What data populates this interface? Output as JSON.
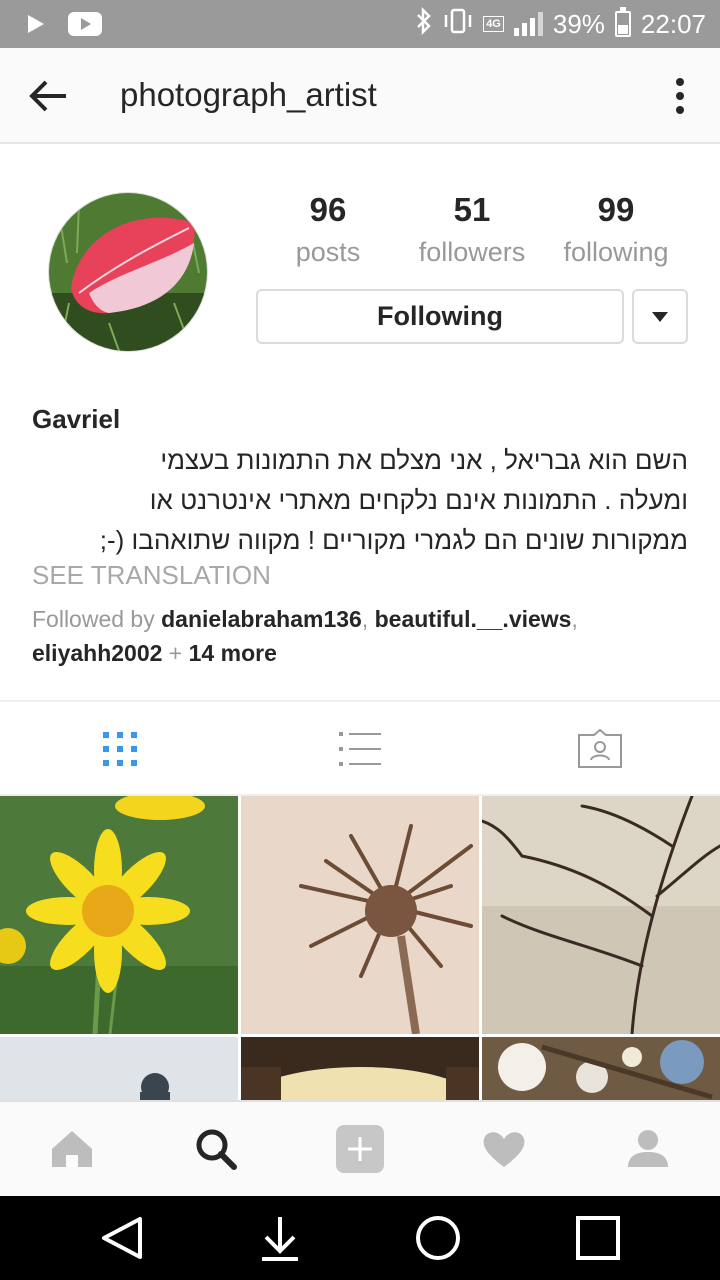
{
  "status_bar": {
    "battery": "39%",
    "time": "22:07",
    "network": "4G"
  },
  "app_bar": {
    "username": "photograph_artist"
  },
  "profile": {
    "stats": [
      {
        "value": "96",
        "label": "posts"
      },
      {
        "value": "51",
        "label": "followers"
      },
      {
        "value": "99",
        "label": "following"
      }
    ],
    "follow_button": "Following",
    "full_name": "Gavriel",
    "bio_lines": [
      "השם הוא גבריאל , אני מצלם את התמונות בעצמי",
      "ומעלה . התמונות אינם נלקחים מאתרי אינטרנט או",
      "ממקורות שונים הם לגמרי מקוריים ! מקווה שתואהבו (-;"
    ],
    "see_translation": "SEE TRANSLATION",
    "followed_by": {
      "prefix": "Followed by",
      "users": [
        "danielabraham136",
        "beautiful.__.views",
        "eliyahh2002"
      ],
      "more": "14 more"
    }
  },
  "tabs": [
    {
      "name": "grid-view-icon",
      "active": true
    },
    {
      "name": "list-view-icon",
      "active": false
    },
    {
      "name": "tagged-photos-icon",
      "active": false
    }
  ],
  "colors": {
    "accent": "#3897f0",
    "icon_inactive": "#999999",
    "status_bar": "#9a9a9a"
  },
  "bottom_nav": [
    "home-icon",
    "search-icon",
    "add-icon",
    "heart-icon",
    "profile-icon"
  ]
}
